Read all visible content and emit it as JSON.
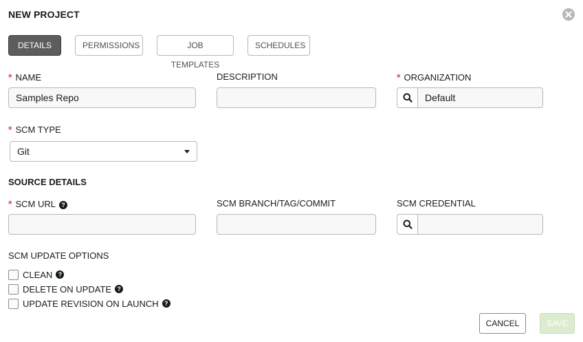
{
  "dialog": {
    "title": "NEW PROJECT"
  },
  "tabs": [
    {
      "label": "DETAILS",
      "active": true
    },
    {
      "label": "PERMISSIONS",
      "active": false
    },
    {
      "label": "JOB TEMPLATES",
      "active": false
    },
    {
      "label": "SCHEDULES",
      "active": false
    }
  ],
  "form": {
    "required_marker": "*",
    "name": {
      "label": "NAME",
      "value": "Samples Repo"
    },
    "description": {
      "label": "DESCRIPTION",
      "value": ""
    },
    "organization": {
      "label": "ORGANIZATION",
      "value": "Default"
    },
    "scm_type": {
      "label": "SCM TYPE",
      "value": "Git"
    },
    "source_details": {
      "title": "SOURCE DETAILS"
    },
    "scm_url": {
      "label": "SCM URL",
      "value": ""
    },
    "scm_branch": {
      "label": "SCM BRANCH/TAG/COMMIT",
      "value": ""
    },
    "scm_credential": {
      "label": "SCM CREDENTIAL",
      "value": ""
    },
    "update_options": {
      "title": "SCM UPDATE OPTIONS",
      "clean": {
        "label": "CLEAN",
        "checked": false
      },
      "delete_on_update": {
        "label": "DELETE ON UPDATE",
        "checked": false
      },
      "update_on_launch": {
        "label": "UPDATE REVISION ON LAUNCH",
        "checked": false
      }
    }
  },
  "actions": {
    "cancel": "CANCEL",
    "save": "SAVE"
  },
  "icons": {
    "close": "close-circle-icon",
    "search": "search-icon",
    "help": "question-circle-icon",
    "dropdown": "caret-down-icon"
  },
  "colors": {
    "required": "#d9534f",
    "active_tab": "#5d5d5d",
    "save_disabled": "#dceccf"
  }
}
